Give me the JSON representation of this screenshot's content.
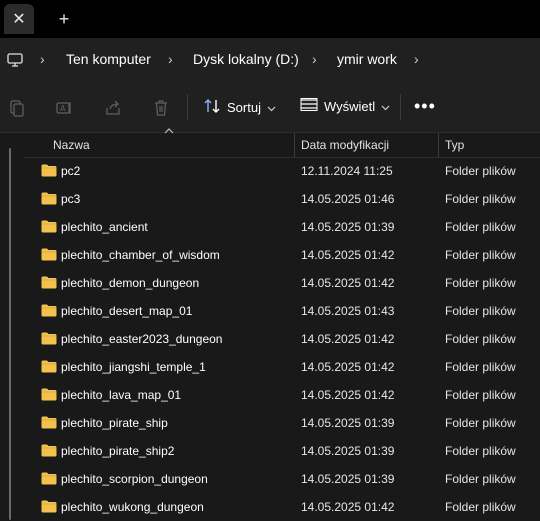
{
  "window": {
    "close_glyph": "✕",
    "new_tab_glyph": "+"
  },
  "address_bar": {
    "separator": "›",
    "breadcrumbs": [
      {
        "label": "Ten komputer"
      },
      {
        "label": "Dysk lokalny (D:)"
      },
      {
        "label": "ymir work"
      }
    ]
  },
  "toolbar": {
    "cut_icon": "cut-icon",
    "rename_icon": "rename-icon",
    "share_icon": "share-icon",
    "delete_icon": "trash-icon",
    "sort_label": "Sortuj",
    "view_label": "Wyświetl",
    "more_glyph": "•••"
  },
  "columns": {
    "name": "Nazwa",
    "date": "Data modyfikacji",
    "type": "Typ"
  },
  "files": [
    {
      "name": "pc2",
      "date": "12.11.2024 11:25",
      "type": "Folder plików"
    },
    {
      "name": "pc3",
      "date": "14.05.2025 01:46",
      "type": "Folder plików"
    },
    {
      "name": "plechito_ancient",
      "date": "14.05.2025 01:39",
      "type": "Folder plików"
    },
    {
      "name": "plechito_chamber_of_wisdom",
      "date": "14.05.2025 01:42",
      "type": "Folder plików"
    },
    {
      "name": "plechito_demon_dungeon",
      "date": "14.05.2025 01:42",
      "type": "Folder plików"
    },
    {
      "name": "plechito_desert_map_01",
      "date": "14.05.2025 01:43",
      "type": "Folder plików"
    },
    {
      "name": "plechito_easter2023_dungeon",
      "date": "14.05.2025 01:42",
      "type": "Folder plików"
    },
    {
      "name": "plechito_jiangshi_temple_1",
      "date": "14.05.2025 01:42",
      "type": "Folder plików"
    },
    {
      "name": "plechito_lava_map_01",
      "date": "14.05.2025 01:42",
      "type": "Folder plików"
    },
    {
      "name": "plechito_pirate_ship",
      "date": "14.05.2025 01:39",
      "type": "Folder plików"
    },
    {
      "name": "plechito_pirate_ship2",
      "date": "14.05.2025 01:39",
      "type": "Folder plików"
    },
    {
      "name": "plechito_scorpion_dungeon",
      "date": "14.05.2025 01:39",
      "type": "Folder plików"
    },
    {
      "name": "plechito_wukong_dungeon",
      "date": "14.05.2025 01:42",
      "type": "Folder plików"
    }
  ],
  "colors": {
    "background": "#191919",
    "chrome": "#202020",
    "folder": "#f2c14e",
    "disabled_icon": "#5f5f5f",
    "accent_icon": "#7fb4ff"
  }
}
